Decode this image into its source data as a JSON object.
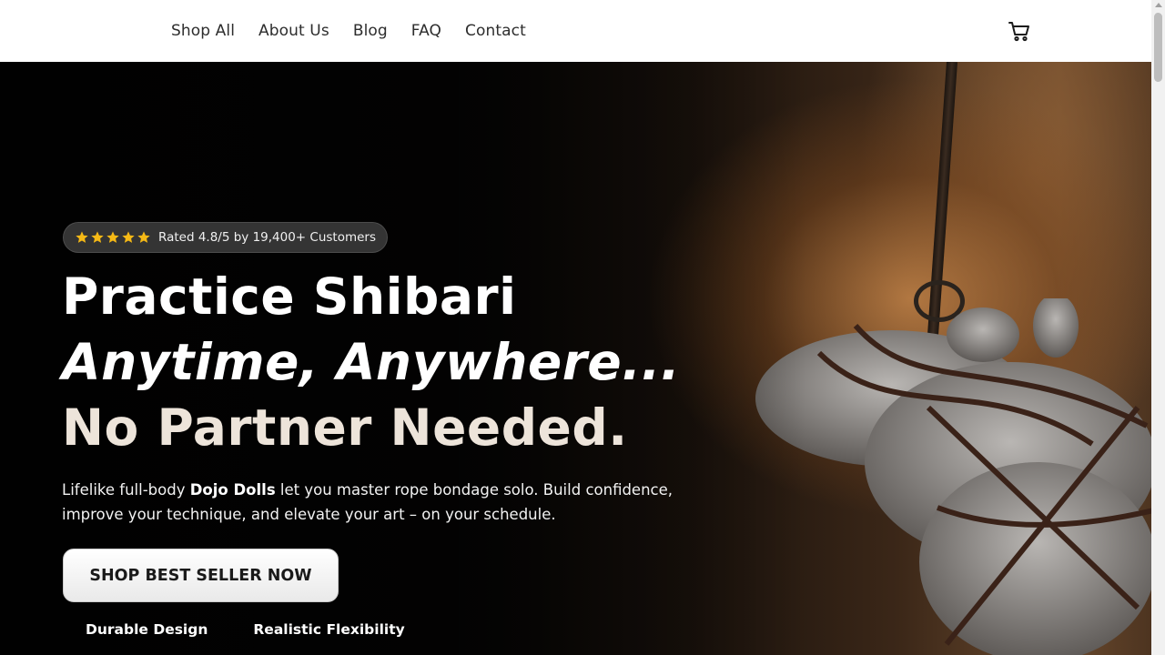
{
  "nav": {
    "items": [
      {
        "label": "Shop All"
      },
      {
        "label": "About Us"
      },
      {
        "label": "Blog"
      },
      {
        "label": "FAQ"
      },
      {
        "label": "Contact"
      }
    ],
    "cart_icon": "cart-icon"
  },
  "hero": {
    "rating": {
      "stars": 5,
      "star_color": "#f5b916",
      "text": "Rated 4.8/5 by 19,400+ Customers"
    },
    "headline_line1": "Practice Shibari",
    "headline_line2": "Anytime, Anywhere...",
    "headline_line3": "No Partner Needed.",
    "subtext_pre": "Lifelike full-body ",
    "subtext_bold": "Dojo Dolls",
    "subtext_post": " let you master rope bondage solo. Build confidence, improve your technique, and elevate your art – on your schedule.",
    "cta_label": "SHOP BEST SELLER NOW",
    "features": [
      "Durable Design",
      "Realistic Flexibility"
    ]
  },
  "colors": {
    "header_bg": "#ffffff",
    "hero_text": "#ffffff",
    "headline_accent": "#ede4da",
    "cta_bg": "#ffffff"
  }
}
